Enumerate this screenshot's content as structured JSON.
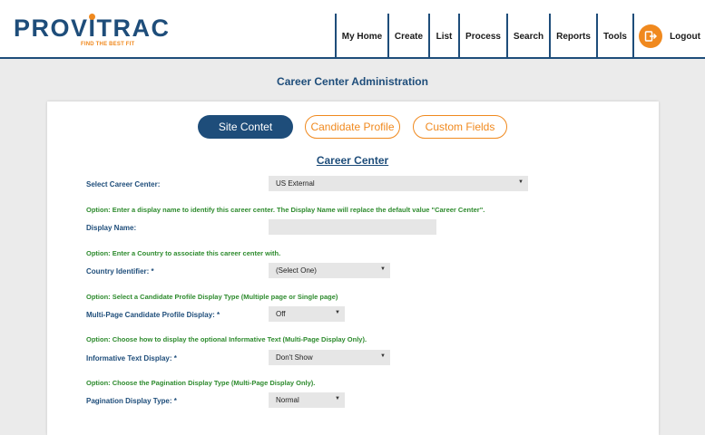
{
  "brand": {
    "name": "PROVITRAC",
    "tagline": "FIND THE BEST FIT"
  },
  "nav": {
    "items": [
      "My Home",
      "Create",
      "List",
      "Process",
      "Search",
      "Reports",
      "Tools"
    ],
    "logout": "Logout"
  },
  "page_title": "Career Center Administration",
  "tabs": [
    "Site Contet",
    "Candidate Profile",
    "Custom Fields"
  ],
  "section_title": "Career Center",
  "form": {
    "career_center_label": "Select Career Center:",
    "career_center_value": "US External",
    "display_name_option": "Option: Enter a display name to identify this career center. The Display Name will replace the default value \"Career Center\".",
    "display_name_label": "Display Name:",
    "display_name_value": "",
    "country_option": "Option: Enter a Country to associate this career center with.",
    "country_label": "Country Identifier: *",
    "country_value": "(Select One)",
    "multipage_option": "Option: Select a Candidate Profile Display Type (Multiple page or Single page)",
    "multipage_label": "Multi-Page Candidate Profile Display: *",
    "multipage_value": "Off",
    "informative_option": "Option: Choose how to display the optional Informative Text (Multi-Page Display Only).",
    "informative_label": "Informative Text Display: *",
    "informative_value": "Don't Show",
    "pagination_option": "Option: Choose the Pagination Display Type (Multi-Page Display Only).",
    "pagination_label": "Pagination Display Type: *",
    "pagination_value": "Normal"
  },
  "colors": {
    "brand_blue": "#1e4d7a",
    "accent_orange": "#f0891e",
    "option_green": "#2e8b2e"
  }
}
